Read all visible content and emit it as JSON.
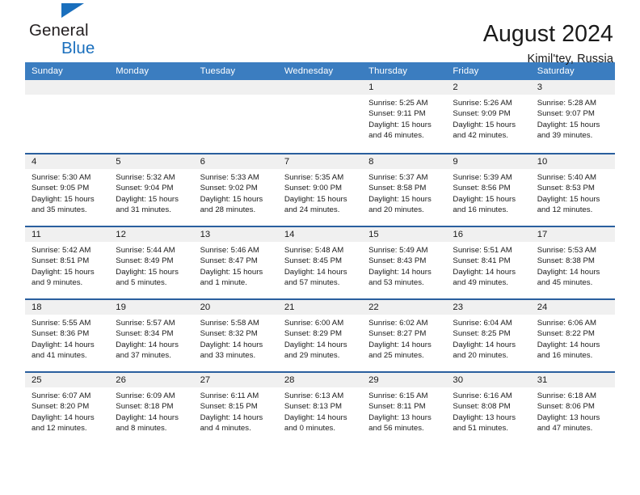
{
  "brand": {
    "line1": "General",
    "line2": "Blue",
    "triangle_color": "#1a6fbd"
  },
  "header": {
    "title": "August 2024",
    "subtitle": "Kimil'tey, Russia",
    "header_bg": "#3b7dc0",
    "row_divider_color": "#2a5f9e",
    "daynum_bg": "#f0f0f0"
  },
  "weekdays": [
    "Sunday",
    "Monday",
    "Tuesday",
    "Wednesday",
    "Thursday",
    "Friday",
    "Saturday"
  ],
  "weeks": [
    [
      {
        "day": "",
        "lines": []
      },
      {
        "day": "",
        "lines": []
      },
      {
        "day": "",
        "lines": []
      },
      {
        "day": "",
        "lines": []
      },
      {
        "day": "1",
        "lines": [
          "Sunrise: 5:25 AM",
          "Sunset: 9:11 PM",
          "Daylight: 15 hours",
          "and 46 minutes."
        ]
      },
      {
        "day": "2",
        "lines": [
          "Sunrise: 5:26 AM",
          "Sunset: 9:09 PM",
          "Daylight: 15 hours",
          "and 42 minutes."
        ]
      },
      {
        "day": "3",
        "lines": [
          "Sunrise: 5:28 AM",
          "Sunset: 9:07 PM",
          "Daylight: 15 hours",
          "and 39 minutes."
        ]
      }
    ],
    [
      {
        "day": "4",
        "lines": [
          "Sunrise: 5:30 AM",
          "Sunset: 9:05 PM",
          "Daylight: 15 hours",
          "and 35 minutes."
        ]
      },
      {
        "day": "5",
        "lines": [
          "Sunrise: 5:32 AM",
          "Sunset: 9:04 PM",
          "Daylight: 15 hours",
          "and 31 minutes."
        ]
      },
      {
        "day": "6",
        "lines": [
          "Sunrise: 5:33 AM",
          "Sunset: 9:02 PM",
          "Daylight: 15 hours",
          "and 28 minutes."
        ]
      },
      {
        "day": "7",
        "lines": [
          "Sunrise: 5:35 AM",
          "Sunset: 9:00 PM",
          "Daylight: 15 hours",
          "and 24 minutes."
        ]
      },
      {
        "day": "8",
        "lines": [
          "Sunrise: 5:37 AM",
          "Sunset: 8:58 PM",
          "Daylight: 15 hours",
          "and 20 minutes."
        ]
      },
      {
        "day": "9",
        "lines": [
          "Sunrise: 5:39 AM",
          "Sunset: 8:56 PM",
          "Daylight: 15 hours",
          "and 16 minutes."
        ]
      },
      {
        "day": "10",
        "lines": [
          "Sunrise: 5:40 AM",
          "Sunset: 8:53 PM",
          "Daylight: 15 hours",
          "and 12 minutes."
        ]
      }
    ],
    [
      {
        "day": "11",
        "lines": [
          "Sunrise: 5:42 AM",
          "Sunset: 8:51 PM",
          "Daylight: 15 hours",
          "and 9 minutes."
        ]
      },
      {
        "day": "12",
        "lines": [
          "Sunrise: 5:44 AM",
          "Sunset: 8:49 PM",
          "Daylight: 15 hours",
          "and 5 minutes."
        ]
      },
      {
        "day": "13",
        "lines": [
          "Sunrise: 5:46 AM",
          "Sunset: 8:47 PM",
          "Daylight: 15 hours",
          "and 1 minute."
        ]
      },
      {
        "day": "14",
        "lines": [
          "Sunrise: 5:48 AM",
          "Sunset: 8:45 PM",
          "Daylight: 14 hours",
          "and 57 minutes."
        ]
      },
      {
        "day": "15",
        "lines": [
          "Sunrise: 5:49 AM",
          "Sunset: 8:43 PM",
          "Daylight: 14 hours",
          "and 53 minutes."
        ]
      },
      {
        "day": "16",
        "lines": [
          "Sunrise: 5:51 AM",
          "Sunset: 8:41 PM",
          "Daylight: 14 hours",
          "and 49 minutes."
        ]
      },
      {
        "day": "17",
        "lines": [
          "Sunrise: 5:53 AM",
          "Sunset: 8:38 PM",
          "Daylight: 14 hours",
          "and 45 minutes."
        ]
      }
    ],
    [
      {
        "day": "18",
        "lines": [
          "Sunrise: 5:55 AM",
          "Sunset: 8:36 PM",
          "Daylight: 14 hours",
          "and 41 minutes."
        ]
      },
      {
        "day": "19",
        "lines": [
          "Sunrise: 5:57 AM",
          "Sunset: 8:34 PM",
          "Daylight: 14 hours",
          "and 37 minutes."
        ]
      },
      {
        "day": "20",
        "lines": [
          "Sunrise: 5:58 AM",
          "Sunset: 8:32 PM",
          "Daylight: 14 hours",
          "and 33 minutes."
        ]
      },
      {
        "day": "21",
        "lines": [
          "Sunrise: 6:00 AM",
          "Sunset: 8:29 PM",
          "Daylight: 14 hours",
          "and 29 minutes."
        ]
      },
      {
        "day": "22",
        "lines": [
          "Sunrise: 6:02 AM",
          "Sunset: 8:27 PM",
          "Daylight: 14 hours",
          "and 25 minutes."
        ]
      },
      {
        "day": "23",
        "lines": [
          "Sunrise: 6:04 AM",
          "Sunset: 8:25 PM",
          "Daylight: 14 hours",
          "and 20 minutes."
        ]
      },
      {
        "day": "24",
        "lines": [
          "Sunrise: 6:06 AM",
          "Sunset: 8:22 PM",
          "Daylight: 14 hours",
          "and 16 minutes."
        ]
      }
    ],
    [
      {
        "day": "25",
        "lines": [
          "Sunrise: 6:07 AM",
          "Sunset: 8:20 PM",
          "Daylight: 14 hours",
          "and 12 minutes."
        ]
      },
      {
        "day": "26",
        "lines": [
          "Sunrise: 6:09 AM",
          "Sunset: 8:18 PM",
          "Daylight: 14 hours",
          "and 8 minutes."
        ]
      },
      {
        "day": "27",
        "lines": [
          "Sunrise: 6:11 AM",
          "Sunset: 8:15 PM",
          "Daylight: 14 hours",
          "and 4 minutes."
        ]
      },
      {
        "day": "28",
        "lines": [
          "Sunrise: 6:13 AM",
          "Sunset: 8:13 PM",
          "Daylight: 14 hours",
          "and 0 minutes."
        ]
      },
      {
        "day": "29",
        "lines": [
          "Sunrise: 6:15 AM",
          "Sunset: 8:11 PM",
          "Daylight: 13 hours",
          "and 56 minutes."
        ]
      },
      {
        "day": "30",
        "lines": [
          "Sunrise: 6:16 AM",
          "Sunset: 8:08 PM",
          "Daylight: 13 hours",
          "and 51 minutes."
        ]
      },
      {
        "day": "31",
        "lines": [
          "Sunrise: 6:18 AM",
          "Sunset: 8:06 PM",
          "Daylight: 13 hours",
          "and 47 minutes."
        ]
      }
    ]
  ]
}
